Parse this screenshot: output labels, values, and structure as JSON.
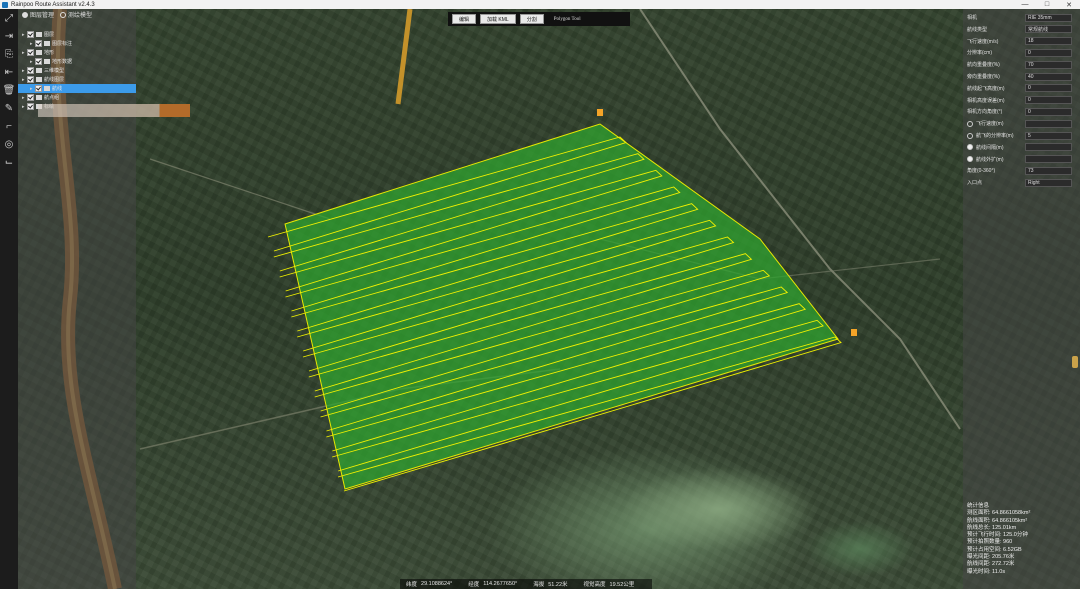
{
  "window": {
    "title": "Rainpoo Route Assistant v2.4.3",
    "controls": [
      "—",
      "□",
      "✕"
    ]
  },
  "left_toolbar": {
    "icons": [
      "open-icon",
      "import-icon",
      "save-as-icon",
      "export-icon",
      "delete-icon",
      "edit-icon",
      "ruler-icon",
      "camera-icon",
      "tool-icon"
    ]
  },
  "layer_panel": {
    "tabs": [
      {
        "label": "图层管理",
        "selected": true
      },
      {
        "label": "测绘模型",
        "selected": false
      }
    ],
    "tree": [
      {
        "label": "图层",
        "indent": 1,
        "checked": true
      },
      {
        "label": "图层标注",
        "indent": 2,
        "checked": true
      },
      {
        "label": "地形",
        "indent": 1,
        "checked": true
      },
      {
        "label": "地形数据",
        "indent": 2,
        "checked": true
      },
      {
        "label": "三维模型",
        "indent": 1,
        "checked": true
      },
      {
        "label": "航线图层",
        "indent": 1,
        "checked": true
      },
      {
        "label": "航线",
        "indent": 2,
        "checked": true,
        "selected": true
      },
      {
        "label": "航点组",
        "indent": 1,
        "checked": true
      },
      {
        "label": "标绘",
        "indent": 1,
        "checked": true
      }
    ]
  },
  "top_toolbar": {
    "buttons": [
      "编辑",
      "加载 KML",
      "分割"
    ],
    "tool_label": "Polygon Tool"
  },
  "params": {
    "rows": [
      {
        "label": "相机",
        "value": "RIE 35mm"
      },
      {
        "label": "航线类型",
        "value": "常规航线"
      },
      {
        "label": "飞行速度(m/s)",
        "value": "18"
      },
      {
        "label": "分辨率(cm)",
        "value": "0"
      },
      {
        "label": "航向重叠度(%)",
        "value": "70"
      },
      {
        "label": "旁向重叠度(%)",
        "value": "40"
      },
      {
        "label": "航线起飞高度(m)",
        "value": "0"
      },
      {
        "label": "相机高度误差(m)",
        "value": "0"
      },
      {
        "label": "相机方向角度(°)",
        "value": "0"
      }
    ],
    "radio_rows": [
      {
        "label": "飞行速度(m)",
        "value": "",
        "selected": false
      },
      {
        "label": "航飞的分辨率(m)",
        "value": "5",
        "selected": false
      },
      {
        "label": "航线间隔(m)",
        "value": "",
        "selected": true
      },
      {
        "label": "航线外扩(m)",
        "value": "",
        "selected": true
      }
    ],
    "extra_rows": [
      {
        "label": "角度(0-360°)",
        "value": "73"
      },
      {
        "label": "入口点",
        "value": "Right"
      }
    ]
  },
  "stats": {
    "title": "统计信息",
    "lines": [
      "测区面积: 64.8661058km²",
      "航线面积: 64.866105km²",
      "航线总长: 125.01km",
      "预计飞行时间: 125.0分钟",
      "预计拍照数量: 960",
      "预计占用空间: 6.52GB",
      "曝光间距: 205.76米",
      "航线间距: 272.72米",
      "曝光时间: 11.0s"
    ]
  },
  "status_bar": {
    "items": [
      {
        "label": "纬度",
        "value": "29.1088624°"
      },
      {
        "label": "经度",
        "value": "114.2677650°"
      },
      {
        "label": "海拔",
        "value": "51.22米"
      },
      {
        "label": "视觉高度",
        "value": "19.52公里"
      }
    ]
  },
  "colors": {
    "route_line": "#f2f200",
    "polygon_fill": "#2fa82f",
    "selection": "#3c9bea"
  }
}
